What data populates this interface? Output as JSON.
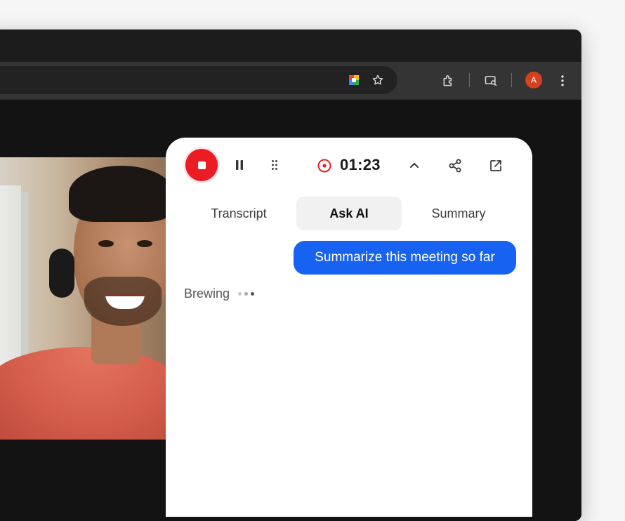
{
  "browser": {
    "profile_initial": "A",
    "icons": [
      "meet-extension-icon",
      "star-icon",
      "puzzle-icon",
      "media-search-icon",
      "kebab-menu-icon"
    ]
  },
  "recorder": {
    "timer": "01:23",
    "tabs": [
      {
        "label": "Transcript",
        "active": false
      },
      {
        "label": "Ask AI",
        "active": true
      },
      {
        "label": "Summary",
        "active": false
      }
    ],
    "prompt": "Summarize this meeting so far",
    "status": "Brewing",
    "colors": {
      "record": "#ec1c24",
      "accent": "#1862f2"
    }
  }
}
